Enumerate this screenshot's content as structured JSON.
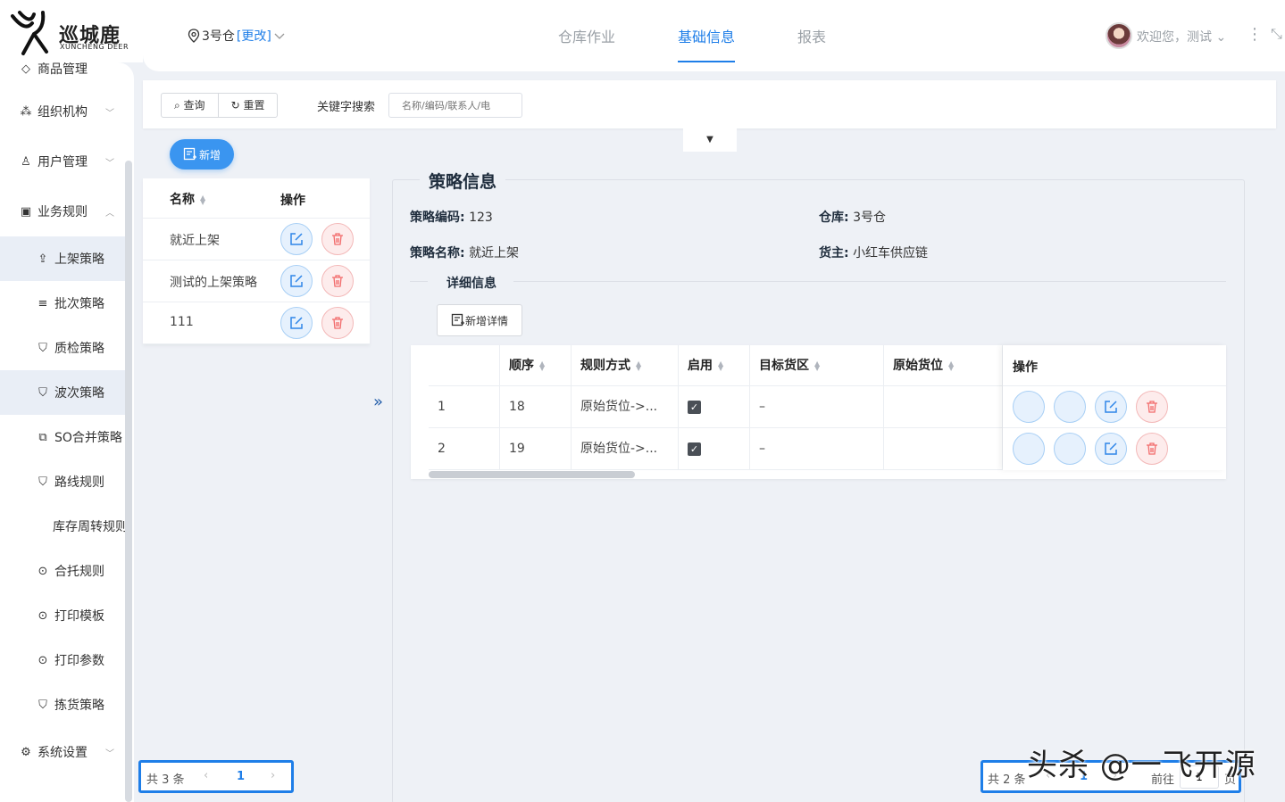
{
  "brand": {
    "name": "巡城鹿",
    "name_en": "XUNCHENG DEER"
  },
  "header": {
    "warehouse": "3号仓",
    "change_label": "[更改]",
    "tabs": [
      {
        "label": "仓库作业",
        "active": false
      },
      {
        "label": "基础信息",
        "active": true
      },
      {
        "label": "报表",
        "active": false
      }
    ],
    "welcome": "欢迎您，测试"
  },
  "sidebar": {
    "items": [
      {
        "label": "商品管理",
        "icon": "box-icon"
      },
      {
        "label": "组织机构",
        "icon": "org-icon",
        "chevron": "down"
      },
      {
        "label": "用户管理",
        "icon": "user-icon",
        "chevron": "down"
      },
      {
        "label": "业务规则",
        "icon": "rules-icon",
        "chevron": "up"
      },
      {
        "label": "上架策略",
        "icon": "upload-icon",
        "active": true
      },
      {
        "label": "批次策略",
        "icon": "list-icon"
      },
      {
        "label": "质检策略",
        "icon": "shield-icon"
      },
      {
        "label": "波次策略",
        "icon": "shield-icon",
        "active": true
      },
      {
        "label": "SO合并策略",
        "icon": "copy-icon"
      },
      {
        "label": "路线规则",
        "icon": "shield-icon"
      },
      {
        "label": "库存周转规则",
        "icon": ""
      },
      {
        "label": "合托规则",
        "icon": "dots-icon"
      },
      {
        "label": "打印模板",
        "icon": "dots-icon"
      },
      {
        "label": "打印参数",
        "icon": "dots-icon"
      },
      {
        "label": "拣货策略",
        "icon": "shield-icon"
      },
      {
        "label": "系统设置",
        "icon": "settings-icon",
        "chevron": "down"
      }
    ]
  },
  "search": {
    "query_label": "查询",
    "reset_label": "重置",
    "keyword_label": "关键字搜索",
    "keyword_placeholder": "名称/编码/联系人/电"
  },
  "add_label": "新增",
  "list": {
    "col_name": "名称",
    "col_ops": "操作",
    "rows": [
      "就近上架",
      "测试的上架策略",
      "111"
    ]
  },
  "strategy": {
    "title": "策略信息",
    "code_label": "策略编码:",
    "code_value": "123",
    "warehouse_label": "仓库:",
    "warehouse_value": "3号仓",
    "name_label": "策略名称:",
    "name_value": "就近上架",
    "owner_label": "货主:",
    "owner_value": "小红车供应链",
    "detail_label": "详细信息",
    "add_detail_label": "新增详情"
  },
  "detail_table": {
    "headers": {
      "order": "顺序",
      "rule": "规则方式",
      "enabled": "启用",
      "target": "目标货区",
      "source": "原始货位",
      "ops": "操作"
    },
    "rows": [
      {
        "idx": "1",
        "order": "18",
        "rule": "原始货位->...",
        "enabled": true,
        "target": "–",
        "source": ""
      },
      {
        "idx": "2",
        "order": "19",
        "rule": "原始货位->...",
        "enabled": true,
        "target": "–",
        "source": ""
      }
    ]
  },
  "pagination_left": {
    "total": "共 3 条",
    "page": "1"
  },
  "pagination_right": {
    "total": "共 2 条",
    "page": "1",
    "goto_label": "前往",
    "goto_value": "1",
    "page_suffix": "页"
  },
  "watermark": "头杀 @一飞开源",
  "colors": {
    "primary": "#1e7ee8",
    "danger": "#f26b6b",
    "background": "#eef1f6"
  }
}
